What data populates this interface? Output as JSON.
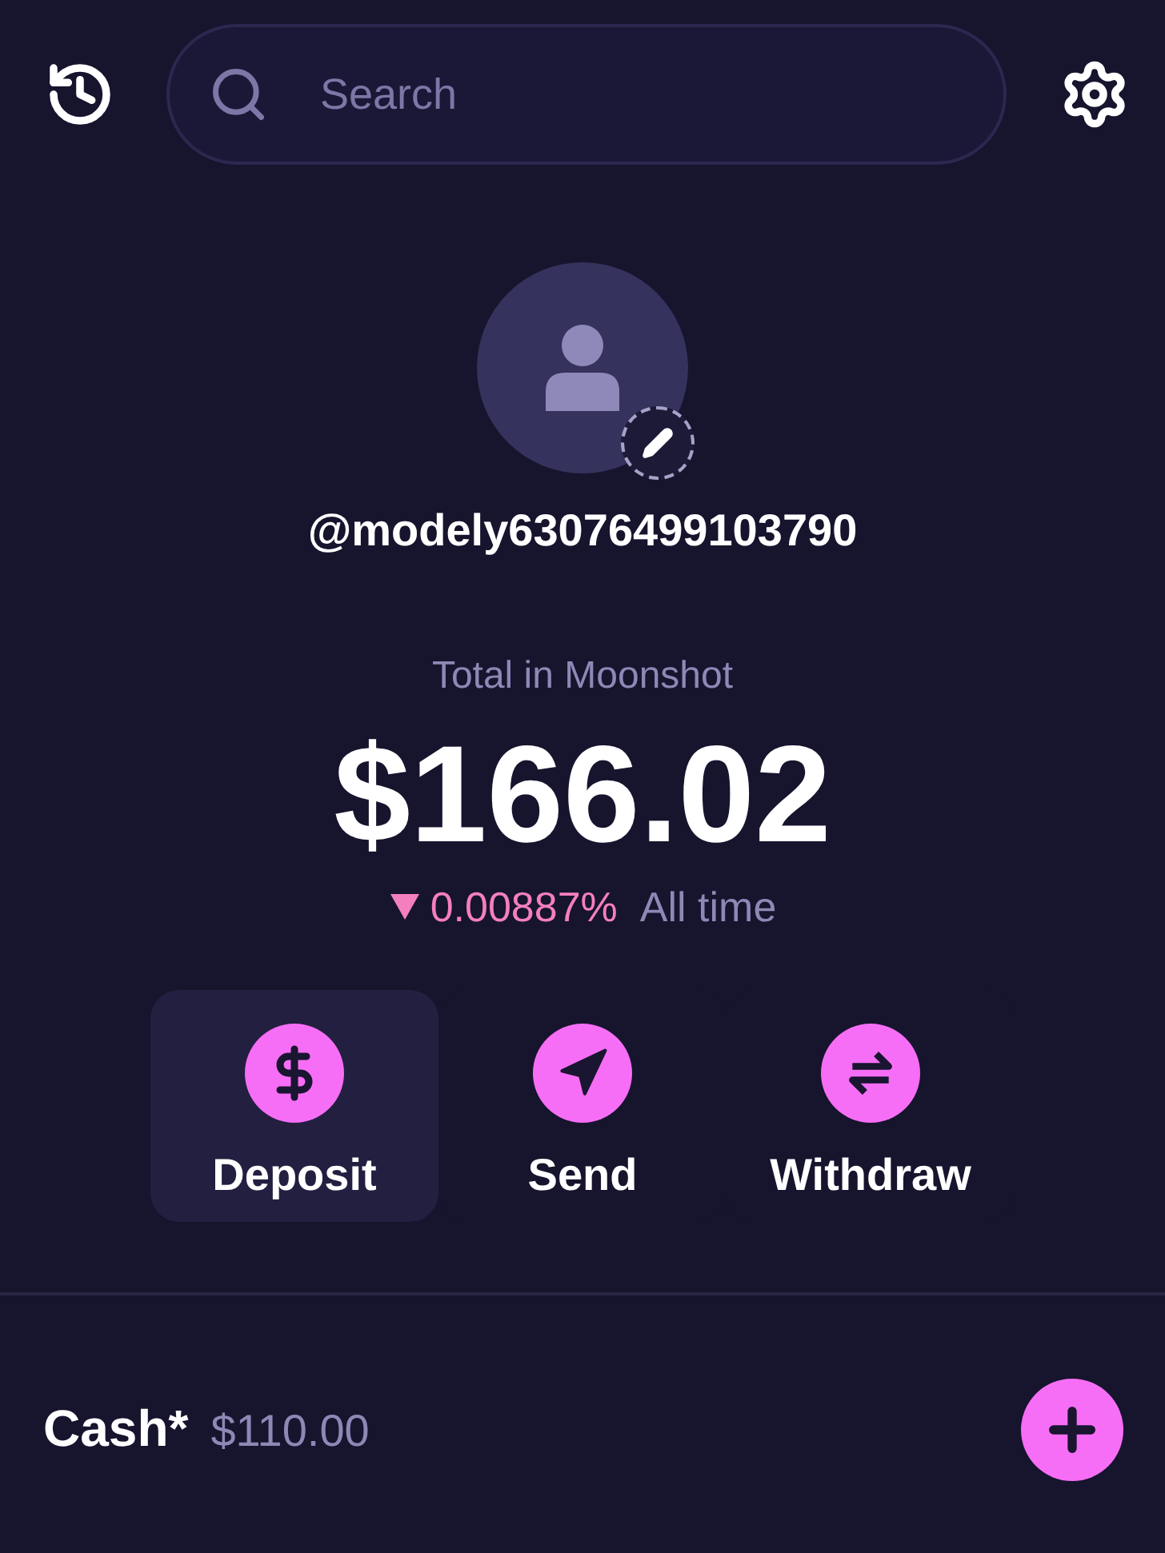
{
  "header": {
    "search": {
      "placeholder": "Search"
    }
  },
  "profile": {
    "username": "@modely63076499103790"
  },
  "balance": {
    "label": "Total in Moonshot",
    "amount": "$166.02",
    "change": {
      "negative": true,
      "value": "0.00887%",
      "period": "All time"
    }
  },
  "actions": [
    {
      "kind": "deposit",
      "label": "Deposit",
      "selected": true
    },
    {
      "kind": "send",
      "label": "Send",
      "selected": false
    },
    {
      "kind": "withdraw",
      "label": "Withdraw",
      "selected": false
    }
  ],
  "accounts": [
    {
      "name": "Cash*",
      "amount": "$110.00"
    }
  ]
}
